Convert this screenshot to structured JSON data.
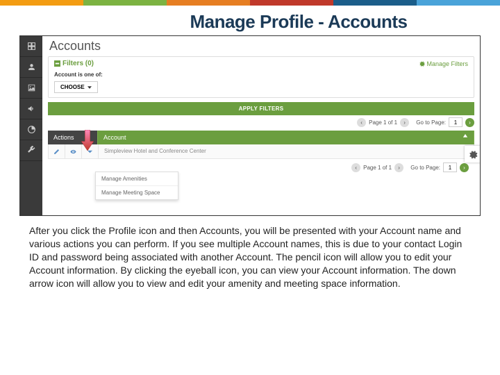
{
  "page_title": "Manage Profile - Accounts",
  "app": {
    "header": "Accounts",
    "filters": {
      "label": "Filters (0)",
      "manage_link": "Manage Filters",
      "field_label": "Account is one of:",
      "choose_btn": "CHOOSE",
      "apply_btn": "APPLY FILTERS"
    },
    "pager": {
      "page_text": "Page 1 of 1",
      "goto_label": "Go to Page:",
      "goto_value": "1"
    },
    "table": {
      "col_actions": "Actions",
      "col_account": "Account",
      "row_account": "Simpleview Hotel and Conference Center"
    },
    "dropdown": {
      "item1": "Manage Amenities",
      "item2": "Manage Meeting Space"
    }
  },
  "description": "After you click the Profile icon and then Accounts, you will be presented with your Account name and various actions you can perform.  If you see multiple Account names, this is due to your contact Login ID and password being associated with another Account.  The pencil icon will allow you to edit your Account information.  By clicking the eyeball icon, you can view your Account information.  The down arrow icon will allow you to view and edit your amenity and meeting space information."
}
